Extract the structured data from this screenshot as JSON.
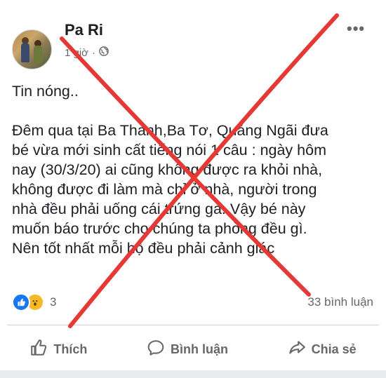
{
  "post": {
    "author": "Pa Ri",
    "time": "1 giờ",
    "meta_separator": "·",
    "privacy_icon": "globe-icon",
    "more_label": "•••",
    "lines": [
      "Tin nóng..",
      "",
      "Đêm qua tại Ba Thành,Ba Tơ, Quảng Ngãi đưa",
      "bé vừa mới sinh cất tiếng nói 1 câu : ngày hôm",
      "nay (30/3/20) ai cũng  không được ra khỏi nhà,",
      "không được đi làm mà chỉ ở nhà, người trong",
      "nhà đều phải uống cái trứng gà. Vậy bé này",
      "muốn báo trước cho  chúng ta phòng đều gì.",
      "Nên tốt nhất  mỗi hộ đều phải cảnh giác"
    ]
  },
  "stats": {
    "reaction_icons": [
      "like-reaction-icon",
      "wow-reaction-icon"
    ],
    "reaction_count": "3",
    "comments": "33 bình luận"
  },
  "actions": {
    "like": "Thích",
    "comment": "Bình luận",
    "share": "Chia sẻ"
  },
  "overlay": {
    "mark": "red-x-cross",
    "color": "#e53935"
  }
}
